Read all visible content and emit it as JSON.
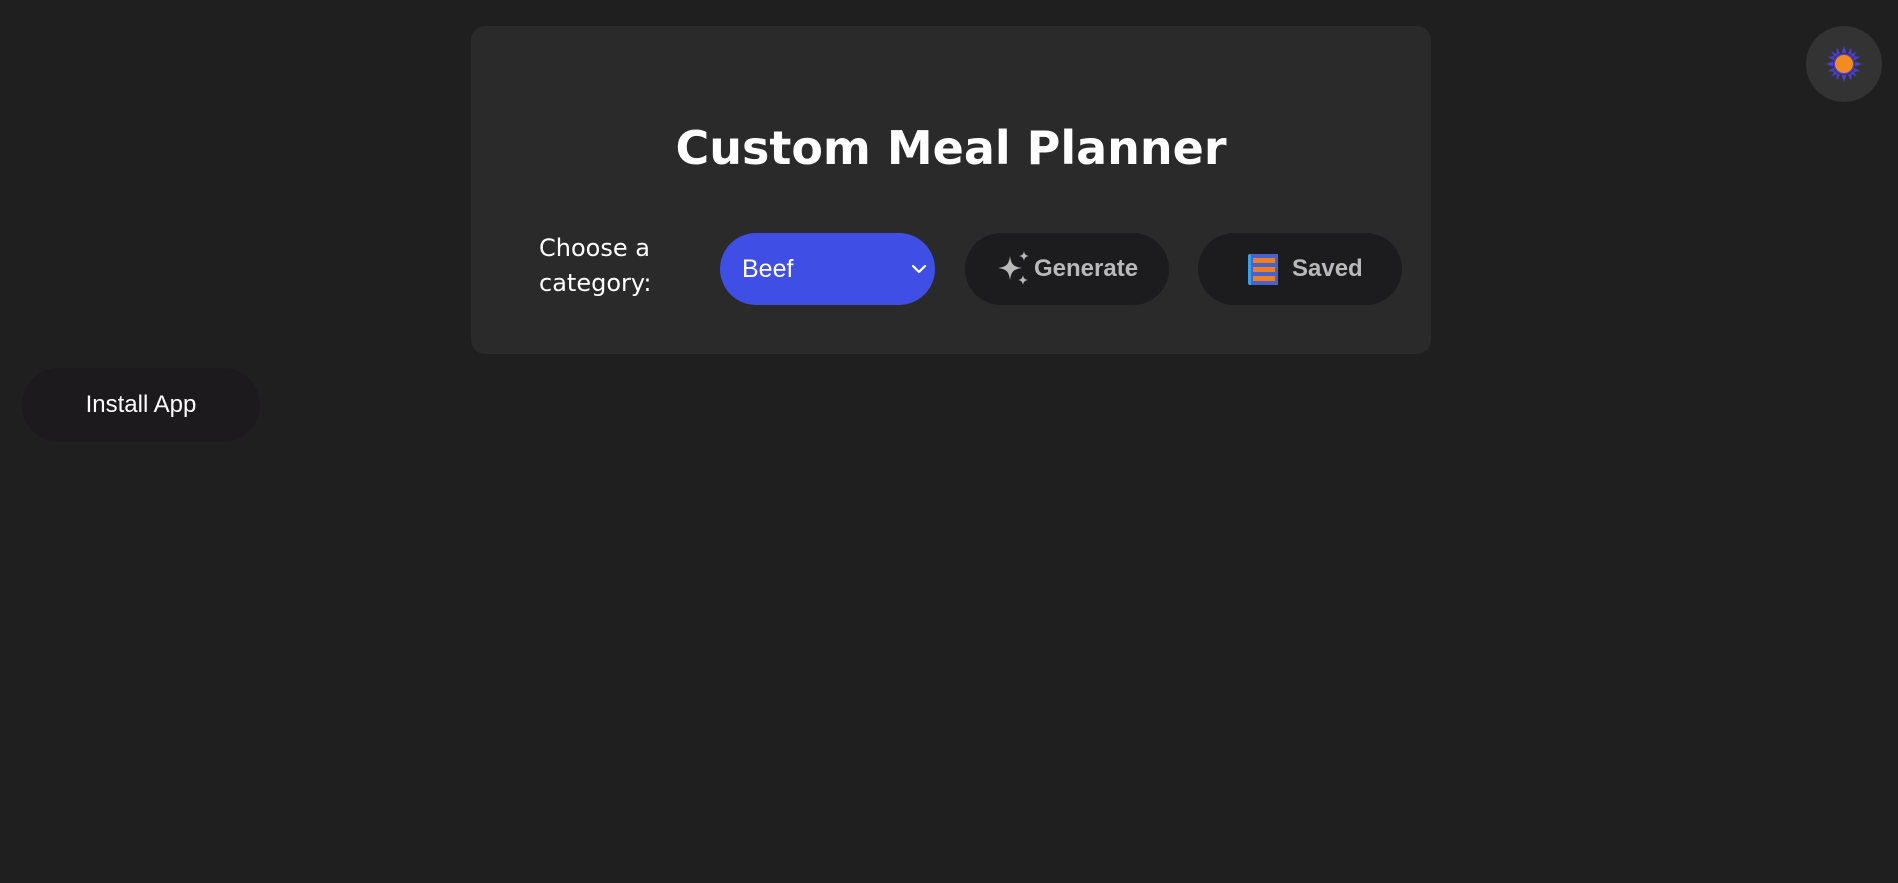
{
  "app": {
    "title": "Custom Meal Planner"
  },
  "controls": {
    "category_label": "Choose a category:",
    "category_select": {
      "selected": "Beef"
    },
    "generate_button": {
      "label": "Generate",
      "icon": "sparkles-icon"
    },
    "saved_button": {
      "label": "Saved",
      "icon": "notebook-icon"
    }
  },
  "install_button": {
    "label": "Install App"
  },
  "theme_toggle": {
    "icon": "sun-icon"
  },
  "colors": {
    "background": "#1f1f1f",
    "card": "#2a2a2a",
    "accent": "#3f4fe6",
    "button_dark": "#1c1b1d",
    "sun_orange": "#f28c1c",
    "sun_rays": "#4b3fd6",
    "notebook_blue": "#3f9fe6",
    "notebook_orange": "#f07e22"
  }
}
